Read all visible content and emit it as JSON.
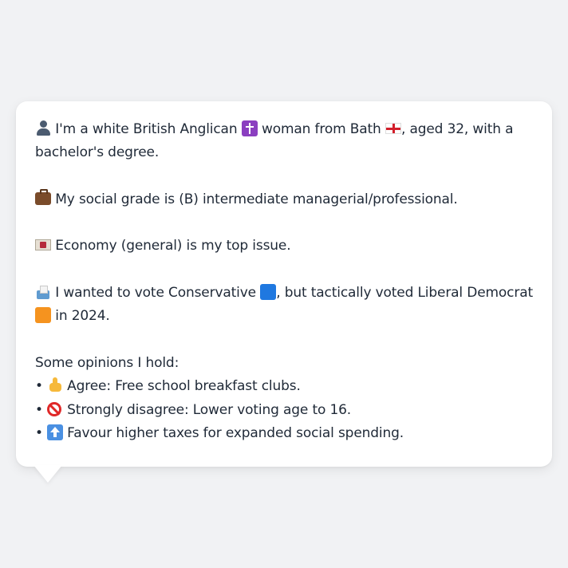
{
  "profile": {
    "intro": {
      "icon": "person-silhouette-icon",
      "before_religion": "I'm a white British Anglican",
      "religion_icon": "latin-cross-icon",
      "mid": "woman from Bath",
      "flag_icon": "england-flag-icon",
      "after_flag": ", aged 32, with a bachelor's degree."
    },
    "social_grade": {
      "icon": "briefcase-icon",
      "text": "My social grade is (B) intermediate managerial/professional."
    },
    "top_issue": {
      "icon": "banknote-icon",
      "text": "Economy (general) is my top issue."
    },
    "vote": {
      "icon": "ballot-box-icon",
      "before": "I wanted to vote Conservative",
      "conservative_icon": "blue-square-icon",
      "mid": ", but tactically voted Liberal Democrat",
      "libdem_icon": "orange-square-icon",
      "after": "in 2024."
    },
    "opinions": {
      "heading": "Some opinions I hold:",
      "items": [
        {
          "bullet": "•",
          "icon": "thumbs-up-icon",
          "text": "Agree: Free school breakfast clubs."
        },
        {
          "bullet": "•",
          "icon": "no-entry-icon",
          "text": "Strongly disagree: Lower voting age to 16."
        },
        {
          "bullet": "•",
          "icon": "up-arrow-icon",
          "text": "Favour higher taxes for expanded social spending."
        }
      ]
    }
  },
  "colors": {
    "background": "#f1f2f4",
    "bubble": "#ffffff",
    "text": "#1f2937",
    "conservative_blue": "#1f78e0",
    "libdem_orange": "#f5931f"
  }
}
